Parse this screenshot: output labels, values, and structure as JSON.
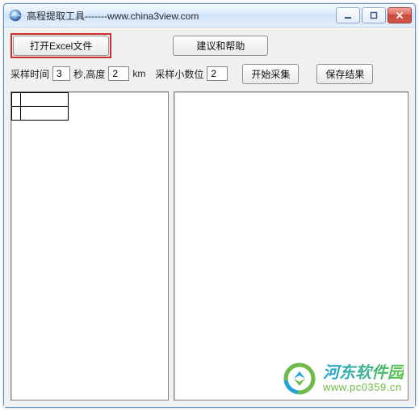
{
  "window": {
    "title": "高程提取工具-------www.china3view.com"
  },
  "toolbar": {
    "open_excel_label": "打开Excel文件",
    "help_label": "建议和帮助"
  },
  "params": {
    "sample_time_label": "采样时间",
    "sample_time_value": "3",
    "seconds_height_label": "秒,高度",
    "height_value": "2",
    "km_label": "km",
    "decimal_label": "采样小数位",
    "decimal_value": "2",
    "start_label": "开始采集",
    "save_label": "保存结果"
  },
  "watermark": {
    "line1": "河东软件园",
    "line2": "www.pc0359.cn"
  }
}
